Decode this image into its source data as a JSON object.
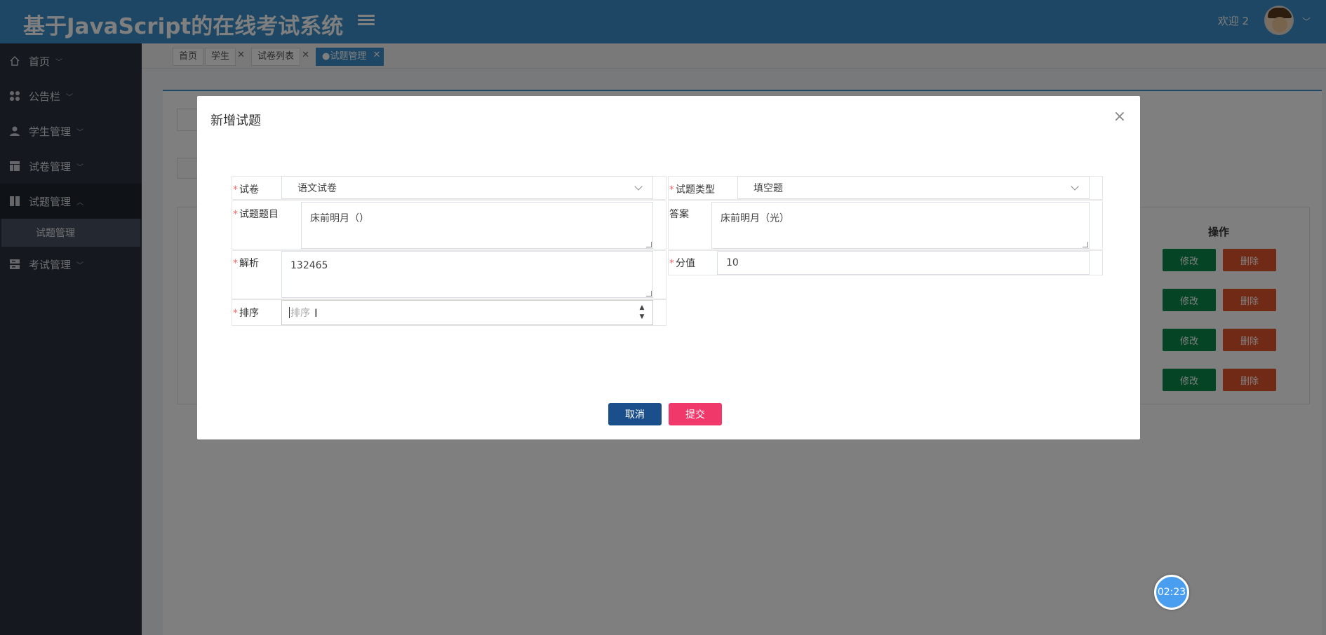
{
  "header": {
    "title": "基于JavaScript的在线考试系统",
    "welcome": "欢迎 2"
  },
  "sidebar": {
    "items": [
      {
        "label": "首页",
        "icon": "home-icon"
      },
      {
        "label": "公告栏",
        "icon": "grid-icon"
      },
      {
        "label": "学生管理",
        "icon": "user-icon"
      },
      {
        "label": "试卷管理",
        "icon": "layout-icon"
      },
      {
        "label": "试题管理",
        "icon": "columns-icon"
      },
      {
        "label": "考试管理",
        "icon": "server-icon"
      }
    ],
    "sub_items": [
      {
        "label": "试题管理"
      }
    ]
  },
  "tabs": [
    {
      "label": "首页"
    },
    {
      "label": "学生"
    },
    {
      "label": "试卷列表"
    },
    {
      "label": "●试题管理"
    }
  ],
  "table": {
    "op_header": "操作",
    "edit_label": "修改",
    "delete_label": "删除"
  },
  "dialog": {
    "title": "新增试题",
    "fields": {
      "paper": {
        "label": "试卷",
        "value": "语文试卷"
      },
      "type": {
        "label": "试题类型",
        "value": "填空题"
      },
      "question": {
        "label": "试题题目",
        "value": "床前明月（）"
      },
      "answer": {
        "label": "答案",
        "value": "床前明月（光）"
      },
      "analysis": {
        "label": "解析",
        "value": "132465"
      },
      "score": {
        "label": "分值",
        "value": "10"
      },
      "order": {
        "label": "排序",
        "placeholder": "排序"
      }
    },
    "cancel_label": "取消",
    "submit_label": "提交"
  },
  "timer": "02:23",
  "colors": {
    "header": "#3a8ec9",
    "sidebar": "#2b333e",
    "edit": "#0b8a4c",
    "delete": "#e0542d",
    "cancel": "#1a4f8c",
    "submit": "#f0386b"
  }
}
